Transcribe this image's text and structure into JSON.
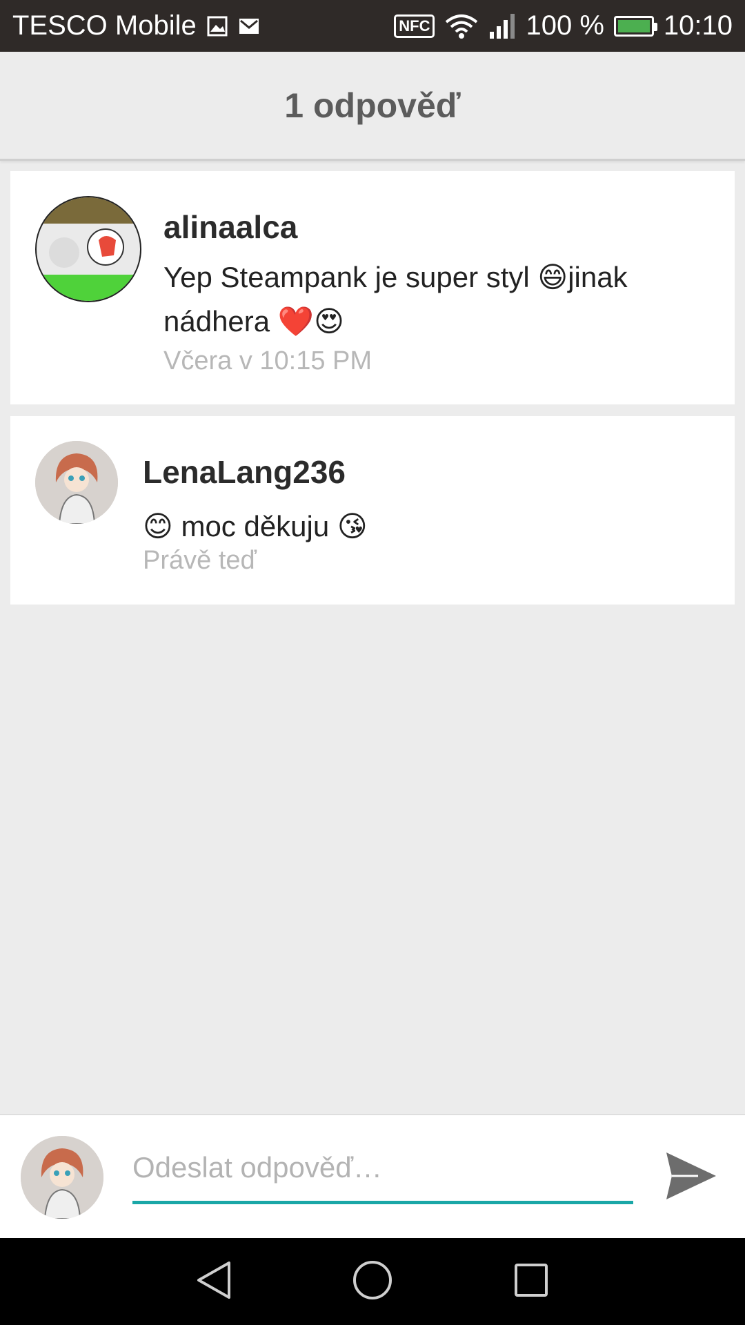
{
  "status_bar": {
    "carrier": "TESCO Mobile",
    "nfc": "NFC",
    "battery": "100 %",
    "time": "10:10",
    "battery_color": "#4caf50"
  },
  "header": {
    "title": "1 odpověď"
  },
  "comments": [
    {
      "username": "alinaalca",
      "message": "Yep Steampank je super styl 😄jinak nádhera ❤️😍",
      "timestamp": "Včera v 10:15 PM"
    },
    {
      "username": "LenaLang236",
      "message": "😊 moc děkuju 😘",
      "timestamp": "Právě teď"
    }
  ],
  "reply": {
    "placeholder": "Odeslat odpověď…",
    "accent_color": "#1aa7a7"
  },
  "icons": {
    "send": "send-icon",
    "back": "back-icon",
    "home": "home-icon",
    "recents": "recents-icon"
  }
}
